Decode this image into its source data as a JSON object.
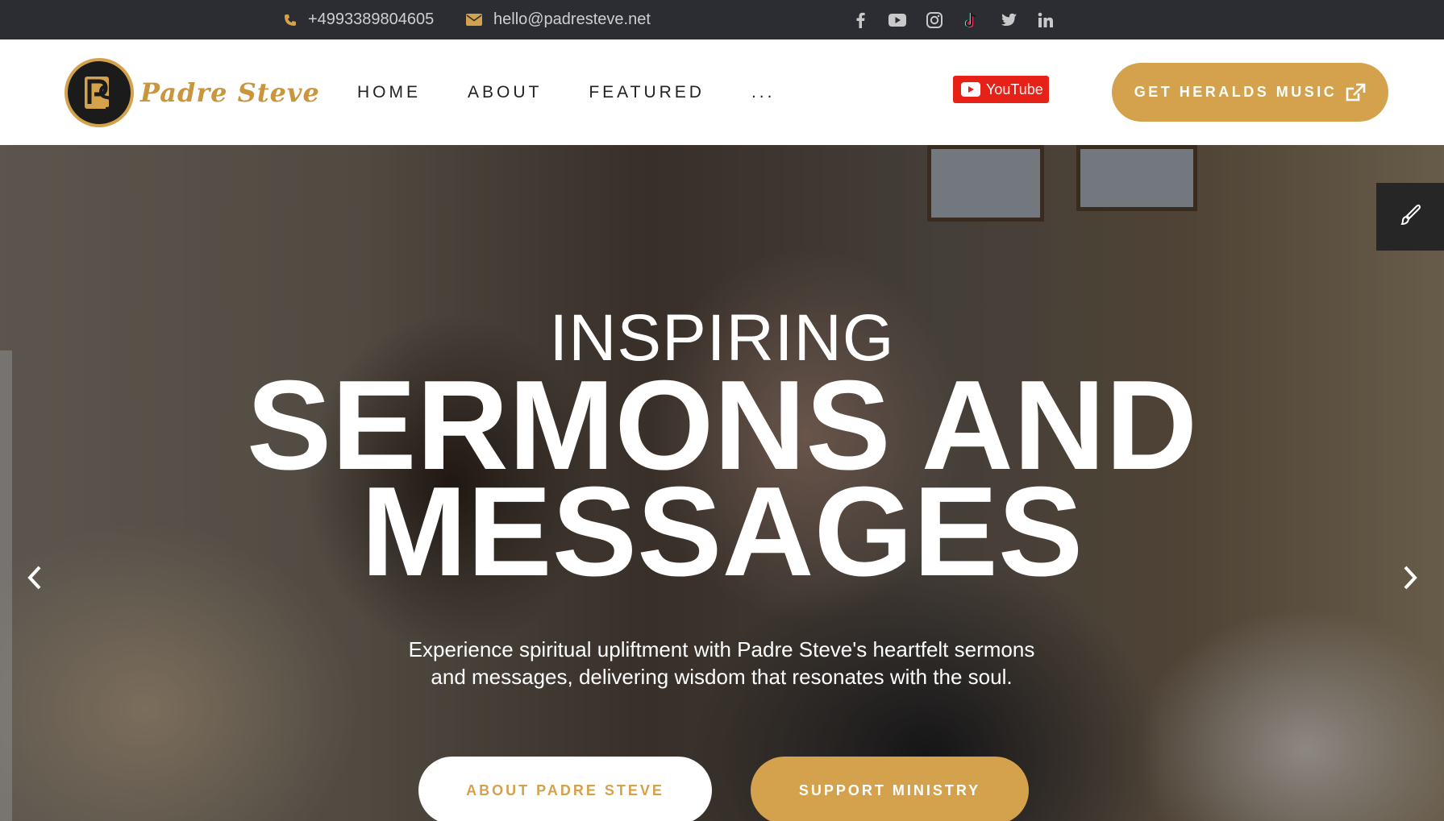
{
  "topbar": {
    "phone": "+4993389804605",
    "email": "hello@padresteve.net",
    "social": [
      "facebook-icon",
      "youtube-icon",
      "instagram-icon",
      "tiktok-icon",
      "twitter-icon",
      "linkedin-icon"
    ]
  },
  "header": {
    "logo_text": "Padre Steve",
    "nav": [
      "HOME",
      "ABOUT",
      "FEATURED",
      "..."
    ],
    "youtube_label": "YouTube",
    "cta_label": "GET HERALDS MUSIC"
  },
  "hero": {
    "kicker": "INSPIRING",
    "headline_line1": "SERMONS AND",
    "headline_line2": "MESSAGES",
    "description": "Experience spiritual upliftment with Padre Steve's heartfelt sermons and messages, delivering wisdom that resonates with the soul.",
    "button_primary": "ABOUT PADRE STEVE",
    "button_secondary": "SUPPORT MINISTRY"
  },
  "colors": {
    "accent": "#d4a24c",
    "topbar_bg": "#2b2d33",
    "youtube_red": "#e62117"
  }
}
